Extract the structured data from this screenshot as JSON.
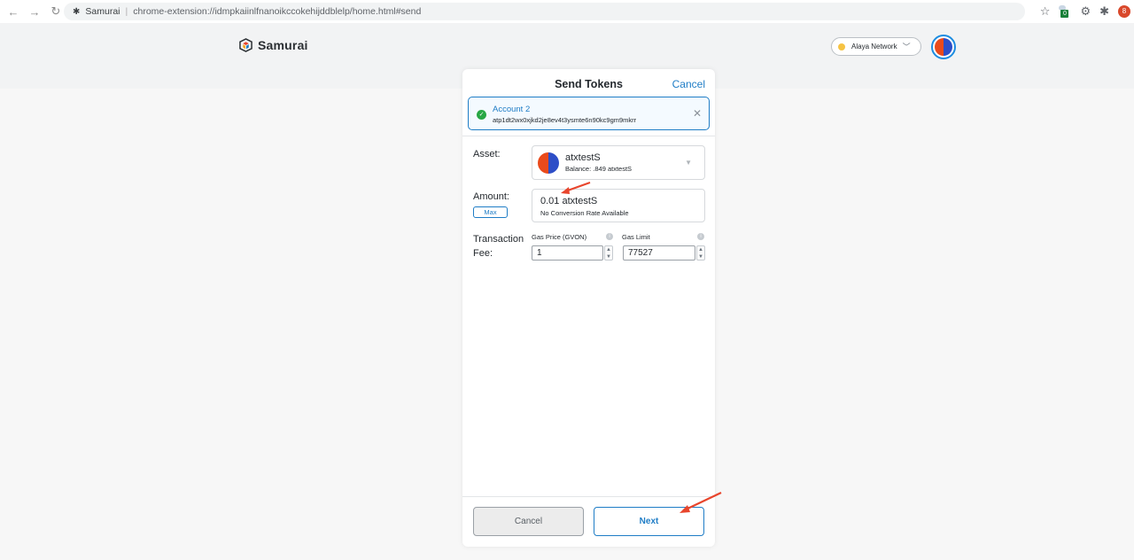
{
  "browser": {
    "site_name": "Samurai",
    "url": "chrome-extension://idmpkaiinlfnanoikccokehijddblelp/home.html#send",
    "extension_badge": "0",
    "profile_initial": "8"
  },
  "header": {
    "logo_text": "Samurai",
    "network_label": "Alaya Network"
  },
  "send": {
    "title": "Send Tokens",
    "cancel_link": "Cancel",
    "recipient": {
      "name": "Account 2",
      "address": "atp1dt2wx0xjkd2je8ev4t3ysmte6n90kc9gm9mkrr"
    },
    "asset": {
      "label": "Asset:",
      "token_name": "atxtestS",
      "balance": "Balance: .849 atxtestS"
    },
    "amount": {
      "label": "Amount:",
      "max_label": "Max",
      "value": "0.01  atxtestS",
      "conversion": "No Conversion Rate Available"
    },
    "fee": {
      "label_line1": "Transaction",
      "label_line2": "Fee:",
      "gas_price_label": "Gas Price (GVON)",
      "gas_price_value": "1",
      "gas_limit_label": "Gas Limit",
      "gas_limit_value": "77527"
    },
    "buttons": {
      "cancel": "Cancel",
      "next": "Next"
    }
  },
  "colors": {
    "accent": "#1f7dc6",
    "success": "#28a745",
    "annotation": "#e8452c"
  }
}
